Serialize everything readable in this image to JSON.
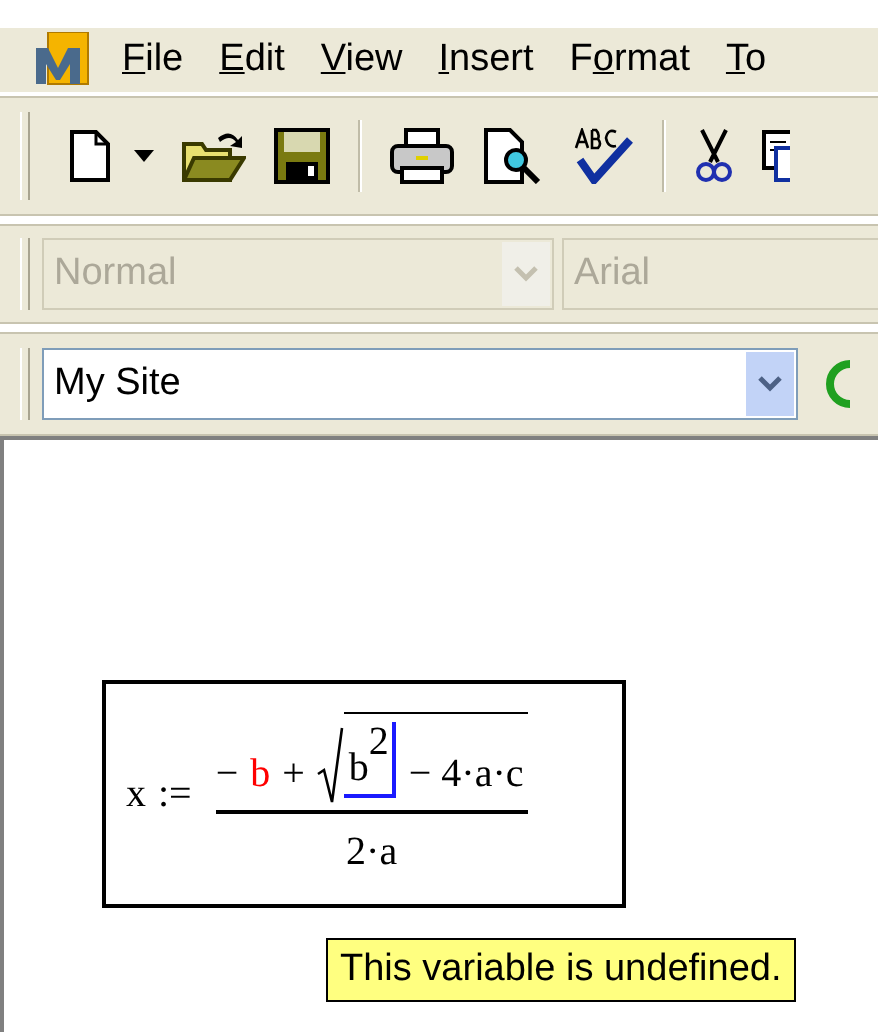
{
  "menu": [
    {
      "key": "F",
      "post": "ile"
    },
    {
      "key": "E",
      "post": "dit"
    },
    {
      "key": "V",
      "post": "iew"
    },
    {
      "key": "I",
      "post": "nsert"
    },
    {
      "pre": "F",
      "key": "o",
      "post": "rmat"
    },
    {
      "key": "T",
      "post": "o"
    }
  ],
  "toolbar": [
    {
      "kind": "new"
    },
    {
      "kind": "caret"
    },
    {
      "kind": "open"
    },
    {
      "kind": "save"
    },
    {
      "kind": "separator"
    },
    {
      "kind": "print"
    },
    {
      "kind": "preview"
    },
    {
      "kind": "spell"
    },
    {
      "kind": "separator"
    },
    {
      "kind": "cut"
    },
    {
      "kind": "copy"
    }
  ],
  "format_bar": {
    "style": {
      "value": "Normal",
      "disabled": true
    },
    "font": {
      "value": "Arial",
      "disabled": true
    }
  },
  "web_bar": {
    "address": {
      "value": "My Site"
    }
  },
  "equation": {
    "lhs": "x",
    "operator": ":=",
    "numerator": [
      {
        "text": "−",
        "undefined": false
      },
      {
        "text": "b",
        "undefined": true
      },
      {
        "text": "+",
        "undefined": false
      }
    ],
    "radical": {
      "base": "b",
      "exponent": "2",
      "tail": "− 4·a·c",
      "cursor": true
    },
    "denominator": "2·a"
  },
  "tooltip": "This variable is undefined."
}
